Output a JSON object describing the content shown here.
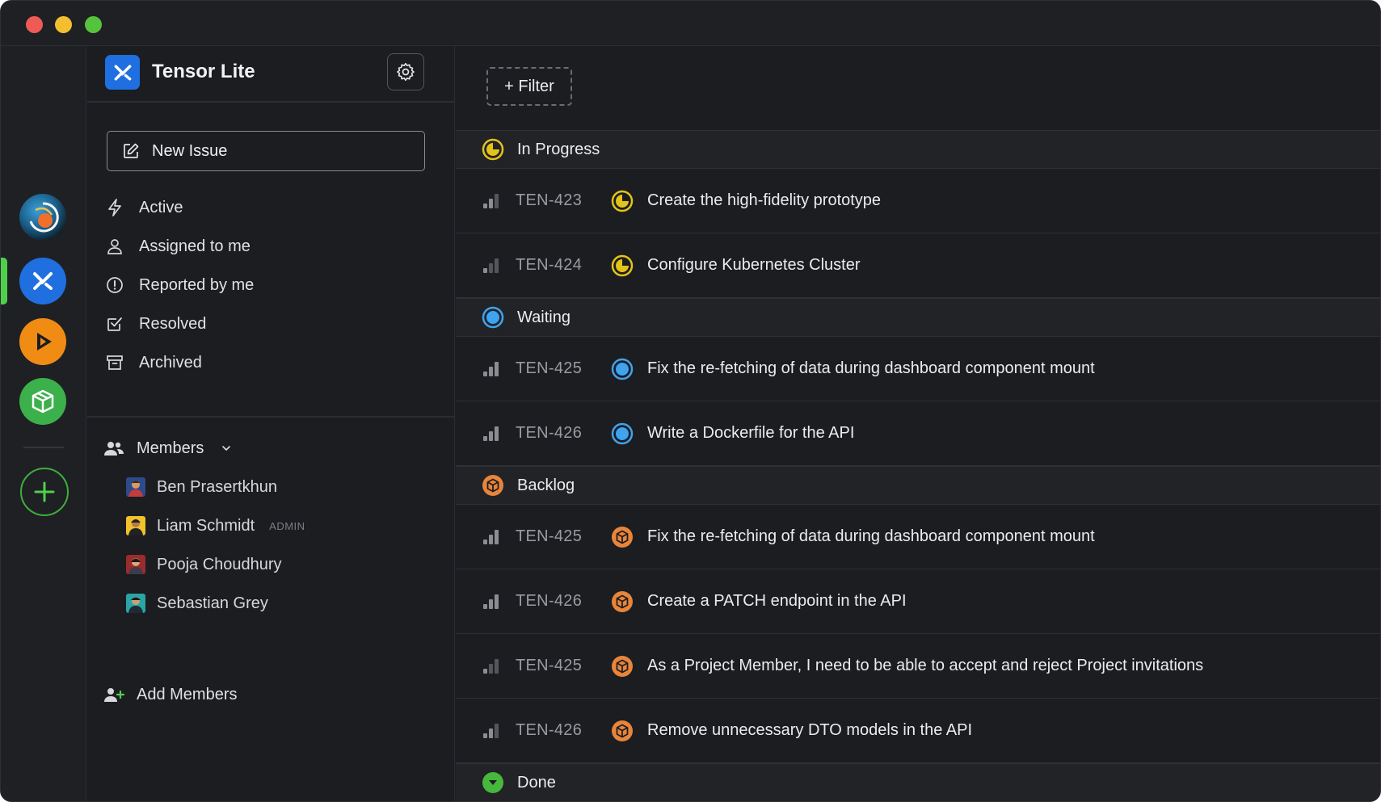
{
  "project": {
    "name": "Tensor Lite"
  },
  "sidebar": {
    "new_issue_label": "New Issue",
    "nav": [
      {
        "label": "Active",
        "icon": "lightning-icon"
      },
      {
        "label": "Assigned to me",
        "icon": "user-icon"
      },
      {
        "label": "Reported by me",
        "icon": "alert-circle-icon"
      },
      {
        "label": "Resolved",
        "icon": "checkbox-icon"
      },
      {
        "label": "Archived",
        "icon": "archive-icon"
      }
    ],
    "members_label": "Members",
    "members": [
      {
        "name": "Ben Prasertkhun",
        "tag": ""
      },
      {
        "name": "Liam Schmidt",
        "tag": "ADMIN"
      },
      {
        "name": "Pooja Choudhury",
        "tag": ""
      },
      {
        "name": "Sebastian Grey",
        "tag": ""
      }
    ],
    "add_members_label": "Add Members"
  },
  "toolbar": {
    "filter_label": "+ Filter"
  },
  "groups": [
    {
      "status": "In Progress",
      "color": "#e3c31a",
      "issues": [
        {
          "key": "TEN-423",
          "title": "Create the high-fidelity prototype"
        },
        {
          "key": "TEN-424",
          "title": "Configure Kubernetes Cluster"
        }
      ]
    },
    {
      "status": "Waiting",
      "color": "#3ea3f0",
      "issues": [
        {
          "key": "TEN-425",
          "title": "Fix the re-fetching of data during dashboard component mount"
        },
        {
          "key": "TEN-426",
          "title": "Write a Dockerfile for the API"
        }
      ]
    },
    {
      "status": "Backlog",
      "color": "#e8853a",
      "issues": [
        {
          "key": "TEN-425",
          "title": "Fix the re-fetching of data during dashboard component mount"
        },
        {
          "key": "TEN-426",
          "title": "Create a PATCH endpoint in the API"
        },
        {
          "key": "TEN-425",
          "title": "As a Project Member, I need to be able to accept and reject Project invitations"
        },
        {
          "key": "TEN-426",
          "title": "Remove unnecessary DTO models in the API"
        }
      ]
    },
    {
      "status": "Done",
      "color": "#46b83c",
      "issues": []
    }
  ]
}
